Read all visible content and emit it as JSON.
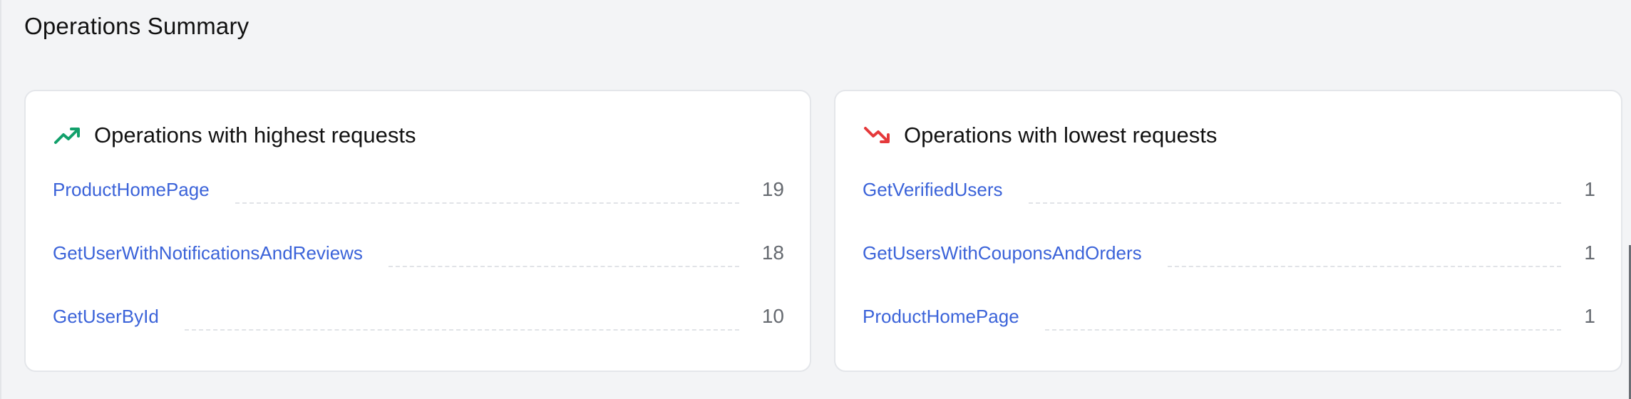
{
  "section": {
    "title": "Operations Summary"
  },
  "highest": {
    "title": "Operations with highest requests",
    "icon": "trending-up-icon",
    "icon_color": "#12a06b",
    "rows": [
      {
        "name": "ProductHomePage",
        "count": "19"
      },
      {
        "name": "GetUserWithNotificationsAndReviews",
        "count": "18"
      },
      {
        "name": "GetUserById",
        "count": "10"
      }
    ]
  },
  "lowest": {
    "title": "Operations with lowest requests",
    "icon": "trending-down-icon",
    "icon_color": "#e5393b",
    "rows": [
      {
        "name": "GetVerifiedUsers",
        "count": "1"
      },
      {
        "name": "GetUsersWithCouponsAndOrders",
        "count": "1"
      },
      {
        "name": "ProductHomePage",
        "count": "1"
      }
    ]
  },
  "colors": {
    "link": "#3b63d9",
    "background": "#f3f4f6",
    "card": "#ffffff"
  }
}
